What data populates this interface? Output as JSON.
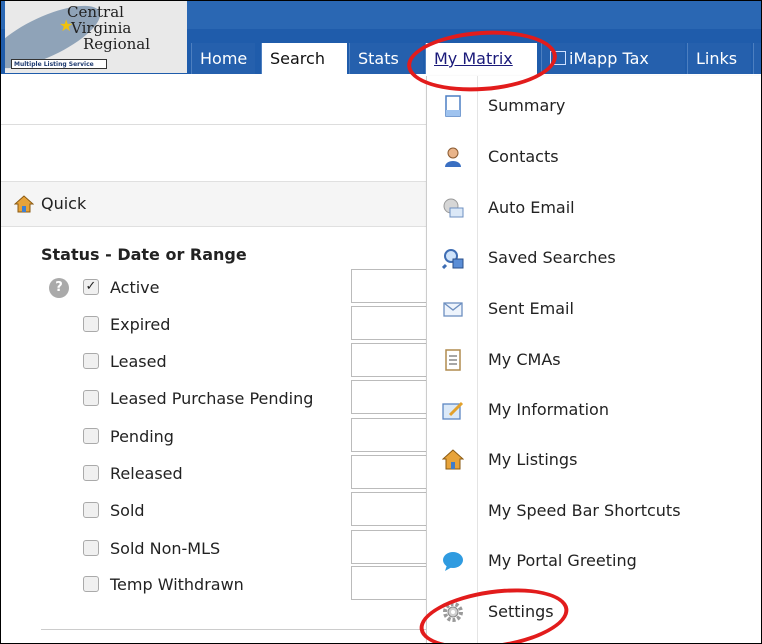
{
  "logo": {
    "line1": "Central",
    "line2": "Virginia",
    "line3": "Regional",
    "band": "Multiple Listing Service"
  },
  "nav": {
    "tabs": [
      {
        "label": "Home"
      },
      {
        "label": "Search"
      },
      {
        "label": "Stats"
      },
      {
        "label": "My Matrix"
      },
      {
        "label": "iMapp Tax"
      },
      {
        "label": "Links"
      }
    ]
  },
  "quick": {
    "label": "Quick"
  },
  "status": {
    "title": "Status - Date or Range",
    "help": "?",
    "items": [
      {
        "label": "Active",
        "checked": true
      },
      {
        "label": "Expired",
        "checked": false
      },
      {
        "label": "Leased",
        "checked": false
      },
      {
        "label": "Leased Purchase Pending",
        "checked": false
      },
      {
        "label": "Pending",
        "checked": false
      },
      {
        "label": "Released",
        "checked": false
      },
      {
        "label": "Sold",
        "checked": false
      },
      {
        "label": "Sold Non-MLS",
        "checked": false
      },
      {
        "label": "Temp Withdrawn",
        "checked": false
      }
    ]
  },
  "menu": {
    "items": [
      {
        "label": "Summary",
        "icon": "document-icon"
      },
      {
        "label": "Contacts",
        "icon": "person-icon"
      },
      {
        "label": "Auto Email",
        "icon": "auto-email-icon"
      },
      {
        "label": "Saved Searches",
        "icon": "saved-search-icon"
      },
      {
        "label": "Sent Email",
        "icon": "envelope-icon"
      },
      {
        "label": "My CMAs",
        "icon": "report-icon"
      },
      {
        "label": "My Information",
        "icon": "edit-info-icon"
      },
      {
        "label": "My Listings",
        "icon": "houses-icon"
      },
      {
        "label": "My Speed Bar Shortcuts",
        "icon": ""
      },
      {
        "label": "My Portal Greeting",
        "icon": "speech-bubble-icon"
      },
      {
        "label": "Settings",
        "icon": "gear-icon"
      }
    ]
  },
  "colors": {
    "nav_bg": "#1f5cab",
    "annotation": "#e21c1c"
  }
}
